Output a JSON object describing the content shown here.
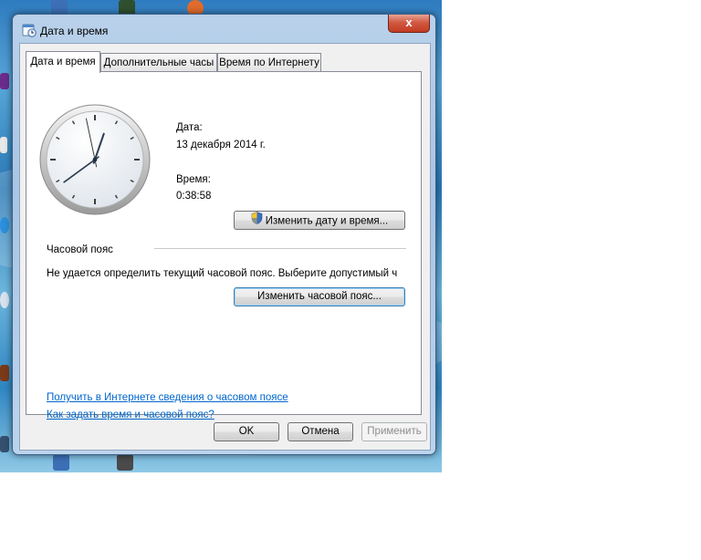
{
  "window": {
    "title": "Дата и время",
    "close_glyph": "x",
    "accent": "#c23a22"
  },
  "tabs": [
    {
      "label": "Дата и время",
      "active": true
    },
    {
      "label": "Дополнительные часы",
      "active": false
    },
    {
      "label": "Время по Интернету",
      "active": false
    }
  ],
  "datetime": {
    "date_label": "Дата:",
    "date_value": "13 декабря 2014 г.",
    "time_label": "Время:",
    "time_value": "0:38:58",
    "change_button": "Изменить дату и время..."
  },
  "clock": {
    "hours": 0,
    "minutes": 38,
    "seconds": 58
  },
  "timezone": {
    "heading": "Часовой пояс",
    "message": "Не удается определить текущий часовой пояс. Выберите допустимый ч",
    "change_button": "Изменить часовой пояс..."
  },
  "links": {
    "timezone_info": "Получить в Интернете сведения о часовом поясе",
    "how_to": "Как задать время и часовой пояс?"
  },
  "footer": {
    "ok": "OK",
    "cancel": "Отмена",
    "apply": "Применить"
  },
  "icons": {
    "title": "clock-calendar-icon",
    "shield": "uac-shield-icon"
  }
}
